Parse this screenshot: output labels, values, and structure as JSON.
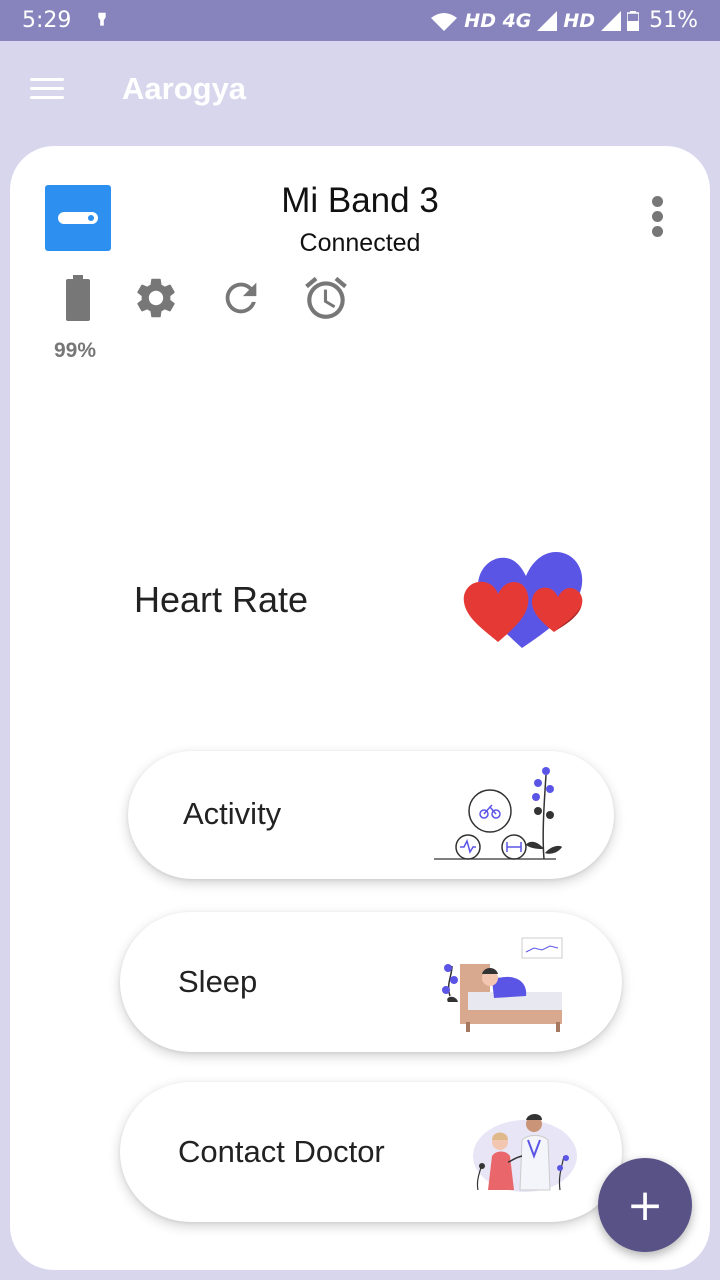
{
  "status_bar": {
    "time": "5:29",
    "network1": "HD 4G",
    "network2": "HD",
    "battery": "51%"
  },
  "app_bar": {
    "title": "Aarogya"
  },
  "device": {
    "name": "Mi Band 3",
    "status": "Connected",
    "battery_percent": "99%"
  },
  "features": {
    "heart_rate": "Heart Rate",
    "activity": "Activity",
    "sleep": "Sleep",
    "contact_doctor": "Contact Doctor"
  },
  "fab": {
    "label": "+"
  },
  "colors": {
    "status_bar": "#8784bd",
    "app_bar": "#d8d6ec",
    "device_icon": "#2d8ff0",
    "fab": "#585286",
    "heart_red": "#e53935",
    "heart_purple": "#5b55e6"
  },
  "icons": [
    "menu-icon",
    "battery-icon",
    "settings-icon",
    "refresh-icon",
    "alarm-icon",
    "more-vert-icon",
    "plus-icon"
  ]
}
